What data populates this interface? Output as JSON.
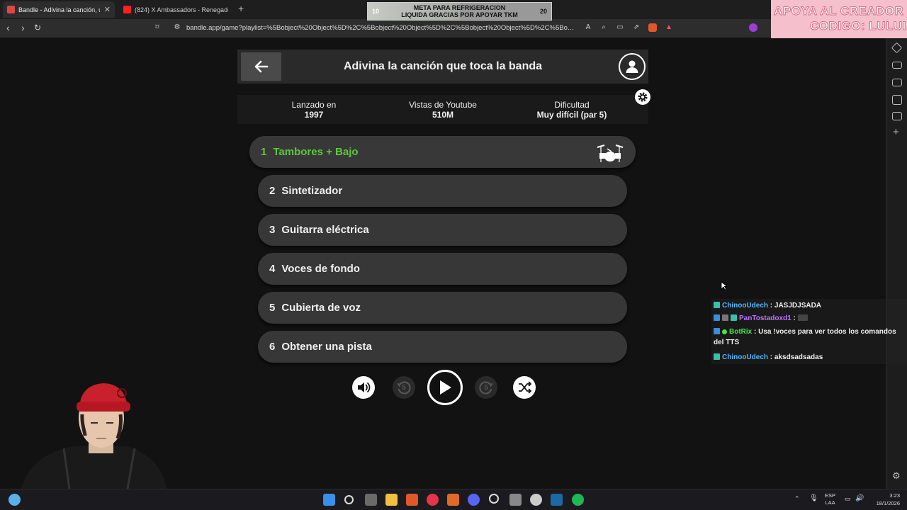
{
  "browser": {
    "tabs": [
      {
        "title": "Bandle - Adivina la canción, un ...",
        "active": true
      },
      {
        "title": "(824) X Ambassadors - Renegades (L..."
      }
    ],
    "new_tab": "+",
    "url": "bandle.app/game?playlist=%5Bobject%20Object%5D%2C%5Bobject%20Object%5D%2C%5Bobject%20Object%5D%2C%5Bobject%20Object%5D%2C%5..."
  },
  "goal_overlay": {
    "title": "META PARA REFRIGERACION",
    "subtitle": "LIQUIDA GRACIAS POR APOYAR TKM",
    "start": "10",
    "end": "20",
    "progress": 0.5
  },
  "creator_banner": {
    "line1": "APOYA AL CREADOR",
    "line2": "CODIGO: LULUI"
  },
  "game": {
    "title": "Adivina la canción que toca la banda",
    "info": [
      {
        "label": "Lanzado en",
        "value": "1997"
      },
      {
        "label": "Vistas de Youtube",
        "value": "510M"
      },
      {
        "label": "Dificultad",
        "value": "Muy difícil (par 5)"
      }
    ],
    "tracks": [
      {
        "num": "1",
        "label": "Tambores + Bajo",
        "active": true,
        "icon": "drum-kit-icon"
      },
      {
        "num": "2",
        "label": "Sintetizador"
      },
      {
        "num": "3",
        "label": "Guitarra eléctrica"
      },
      {
        "num": "4",
        "label": "Voces de fondo"
      },
      {
        "num": "5",
        "label": "Cubierta de voz"
      },
      {
        "num": "6",
        "label": "Obtener una pista"
      }
    ],
    "controls": {
      "rewind_seconds": "5",
      "forward_seconds": "5"
    },
    "accent": "#5dc93a"
  },
  "chat": [
    {
      "user": "ChinooUdech",
      "text": "JASJDJSADA",
      "user_color": "#4fb8ff"
    },
    {
      "user": "PanTostadoxd1",
      "text": "",
      "user_color": "#c070ff"
    },
    {
      "user": "BotRix",
      "text": "Usa !voces para ver todos los comandos del TTS",
      "user_color": "#4de04d"
    },
    {
      "user": "ChinooUdech",
      "text": "aksdsadsadas",
      "user_color": "#4fb8ff"
    }
  ],
  "taskbar": {
    "lang": [
      "ESP",
      "LAA"
    ],
    "time": "3:23",
    "date": "18/1/2026"
  }
}
